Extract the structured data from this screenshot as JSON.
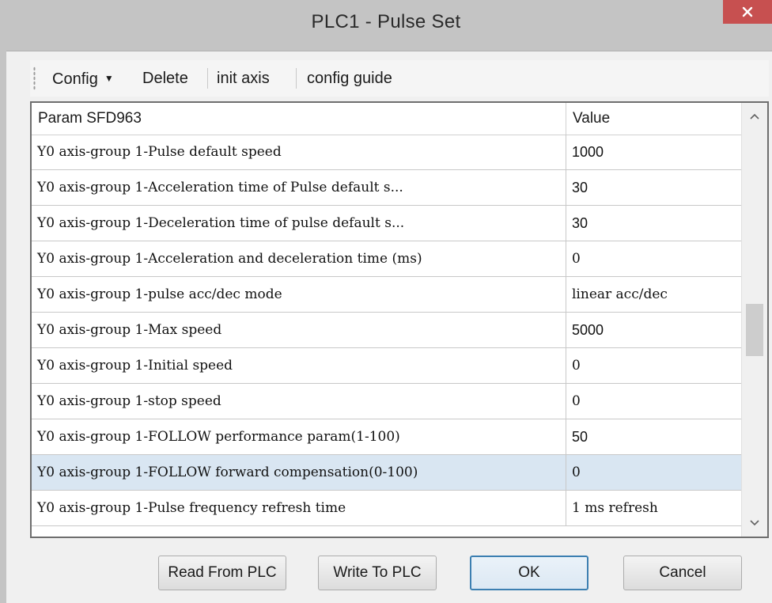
{
  "window": {
    "title": "PLC1 - Pulse  Set",
    "close_glyph": "✕"
  },
  "toolbar": {
    "config_label": "Config",
    "delete_label": "Delete",
    "init_axis_label": "init axis",
    "config_guide_label": "config guide"
  },
  "grid": {
    "headers": {
      "param": "Param SFD963",
      "value": "Value"
    },
    "rows": [
      {
        "param": "Y0 axis-group 1-Pulse default speed",
        "value": "1000"
      },
      {
        "param": "Y0 axis-group 1-Acceleration time of Pulse default s...",
        "value": "30"
      },
      {
        "param": "Y0 axis-group 1-Deceleration time of pulse default s...",
        "value": "30"
      },
      {
        "param": "Y0 axis-group 1-Acceleration and deceleration time (ms)",
        "value": "0"
      },
      {
        "param": "Y0 axis-group 1-pulse acc/dec mode",
        "value": "linear acc/dec"
      },
      {
        "param": "Y0 axis-group 1-Max speed",
        "value": "5000"
      },
      {
        "param": "Y0 axis-group 1-Initial speed",
        "value": "0"
      },
      {
        "param": "Y0 axis-group 1-stop speed",
        "value": "0"
      },
      {
        "param": "Y0 axis-group 1-FOLLOW performance param(1-100)",
        "value": "50"
      },
      {
        "param": "Y0 axis-group 1-FOLLOW forward compensation(0-100)",
        "value": "0"
      },
      {
        "param": "Y0 axis-group 1-Pulse frequency refresh time",
        "value": "1 ms refresh"
      }
    ],
    "selected_row_index": 9
  },
  "buttons": {
    "read": "Read From PLC",
    "write": "Write To PLC",
    "ok": "OK",
    "cancel": "Cancel"
  },
  "colors": {
    "close_button": "#c75050",
    "selected_row": "#d9e6f2",
    "titlebar": "#c4c4c4"
  },
  "icons": {
    "close": "close-icon",
    "config_dropdown": "chevron-down-icon",
    "scroll_up": "scroll-up-icon",
    "scroll_down": "scroll-down-icon"
  }
}
